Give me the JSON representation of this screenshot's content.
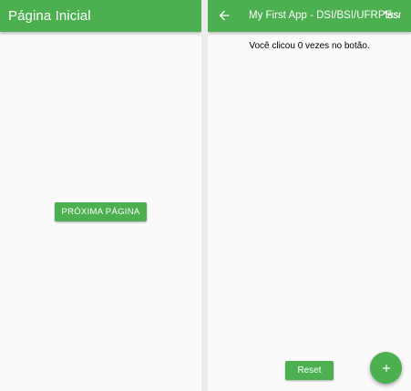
{
  "left_screen": {
    "appbar": {
      "title": "Página Inicial"
    },
    "next_button": {
      "label": "PRÓXIMA PÁGINA"
    }
  },
  "right_screen": {
    "appbar": {
      "title": "My First App - DSI/BSI/UFRPE",
      "back_icon": "arrow-back-icon",
      "logo_text": "BSI"
    },
    "counter": {
      "text": "Você clicou 0 vezes no botão.",
      "count": 0
    },
    "reset_button": {
      "label": "Reset"
    },
    "fab": {
      "icon": "add-icon"
    }
  },
  "colors": {
    "primary": "#4caf50",
    "background": "#fafafa",
    "on_primary": "#ffffff",
    "divider": "#ececec"
  }
}
